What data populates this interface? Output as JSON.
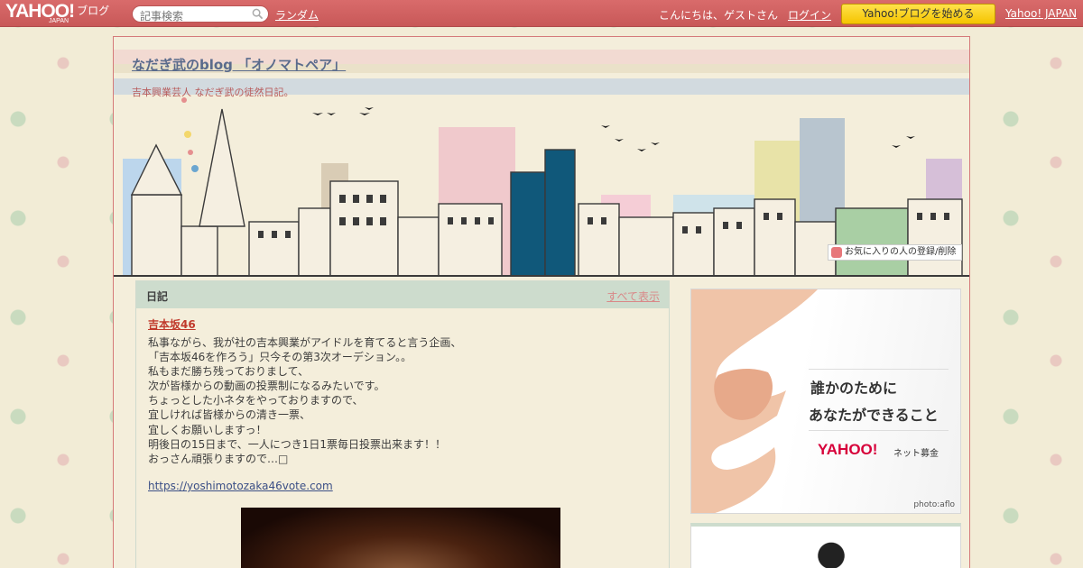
{
  "header": {
    "logo_main": "YAHOO!",
    "logo_sub": "JAPAN",
    "logo_blog": "ブログ",
    "search_placeholder": "記事検索",
    "random_label": "ランダム",
    "greeting": "こんにちは、ゲストさん",
    "login_label": "ログイン",
    "start_blog_label": "Yahoo!ブログを始める",
    "yahoo_japan_label": "Yahoo! JAPAN"
  },
  "blog": {
    "title": "なだぎ武のblog 「オノマトペア」",
    "description": "吉本興業芸人 なだぎ武の徒然日記。",
    "favorite_label": "お気に入りの人の登録/削除"
  },
  "panel": {
    "title": "日記",
    "show_all_label": "すべて表示"
  },
  "entry": {
    "title": "吉本坂46",
    "lines": [
      "私事ながら、我が社の吉本興業がアイドルを育てると言う企画、",
      "「吉本坂46を作ろう」只今その第3次オーデション。。",
      "私もまだ勝ち残っておりまして、",
      "次が皆様からの動画の投票制になるみたいです。",
      "ちょっとした小ネタをやっておりますので、",
      "宜しければ皆様からの清き一票、",
      "宜しくお願いしますっ！",
      "明後日の15日まで、一人につき1日1票毎日投票出来ます！！",
      "おっさん頑張りますので…□"
    ],
    "link": "https://yoshimotozaka46vote.com"
  },
  "ad": {
    "line1": "誰かのために",
    "line2": "あなたができること",
    "logo": "YAHOO!",
    "logo_sub": "ネット募金",
    "credit": "photo:aflo"
  },
  "colors": {
    "topbar": "#d96b6b",
    "start_button": "#f5c400",
    "accent_green": "#cddccd"
  }
}
